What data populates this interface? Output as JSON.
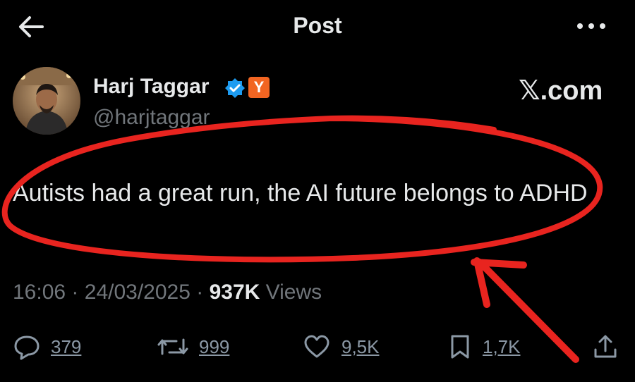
{
  "header": {
    "title": "Post"
  },
  "author": {
    "display_name": "Harj Taggar",
    "handle": "@harjtaggar",
    "badge_text": "Y"
  },
  "watermark": "𝕏.com",
  "tweet": {
    "text": "Autists had a great run, the AI future belongs to ADHD"
  },
  "meta": {
    "time": "16:06",
    "separator": "·",
    "date": "24/03/2025",
    "views_count": "937K",
    "views_label": "Views"
  },
  "actions": {
    "replies": "379",
    "reposts": "999",
    "likes": "9,5K",
    "bookmarks": "1,7K"
  },
  "colors": {
    "background": "#000000",
    "text": "#e7e9ea",
    "muted": "#71767b",
    "verified": "#1d9bf0",
    "yc_badge": "#f26522",
    "annotation": "#e8241f"
  },
  "icons": [
    "back-arrow-icon",
    "more-icon",
    "verified-icon",
    "reply-icon",
    "repost-icon",
    "like-icon",
    "bookmark-icon",
    "share-icon"
  ]
}
